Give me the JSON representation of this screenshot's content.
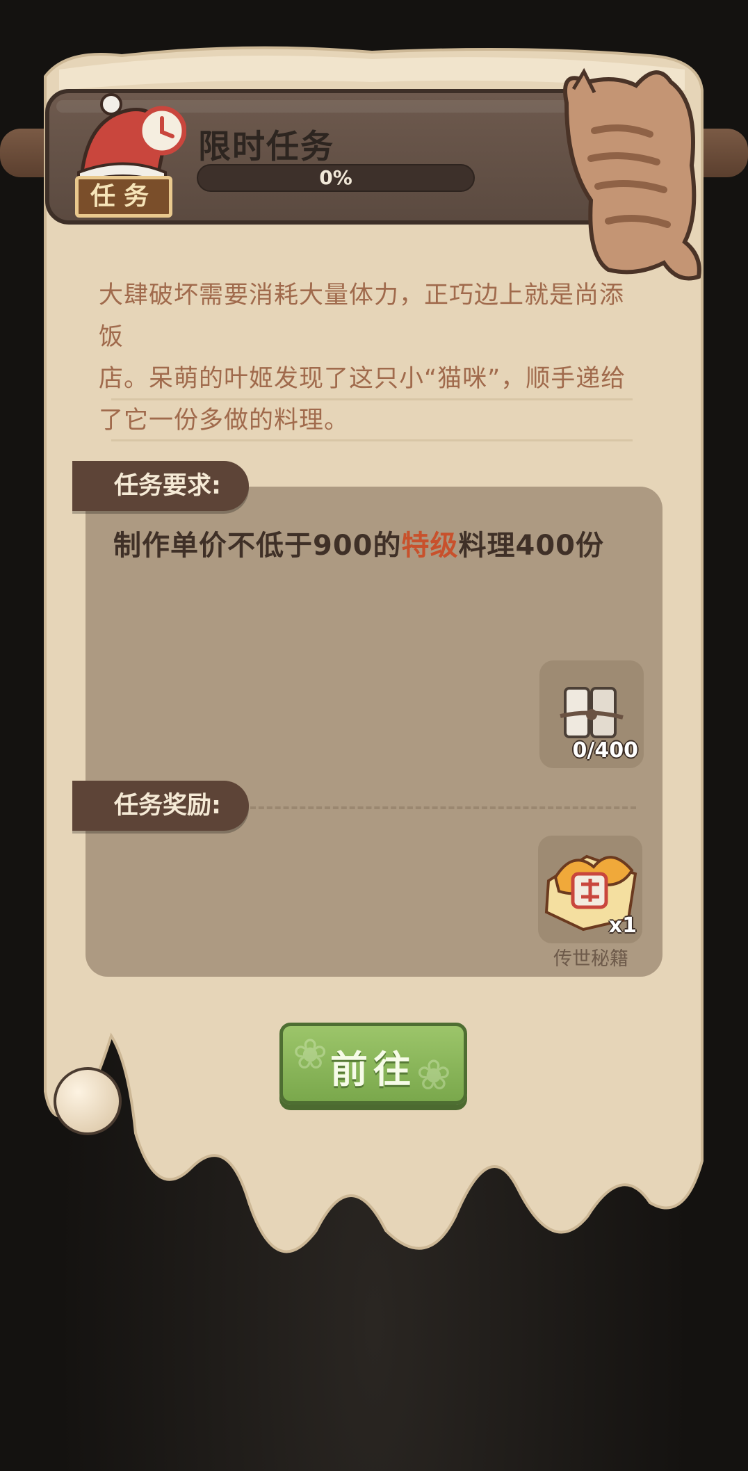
{
  "header": {
    "title": "限时任务",
    "progress_text": "0%",
    "progress_value": 0,
    "badge_label": "任务"
  },
  "description": {
    "line1": "大肆破坏需要消耗大量体力，正巧边上就是尚添饭",
    "line2": "店。呆萌的叶姬发现了这只小“猫咪”，顺手递给",
    "line3": "了它一份多做的料理。"
  },
  "requirement": {
    "tag_label": "任务要求:",
    "text_before": "制作单价不低于900的",
    "text_highlight": "特级",
    "text_after": "料理400份",
    "item_count": "0/400",
    "item_icon": "paper-scroll-bundle-icon"
  },
  "reward": {
    "tag_label": "任务奖励:",
    "item_count": "x1",
    "item_name": "传世秘籍",
    "item_icon": "secret-book-icon"
  },
  "actions": {
    "go_label": "前往"
  },
  "colors": {
    "highlight": "#c8512c",
    "button_green": "#8bb85a",
    "paper": "#e6d5b8",
    "panel": "#ad9a82"
  }
}
